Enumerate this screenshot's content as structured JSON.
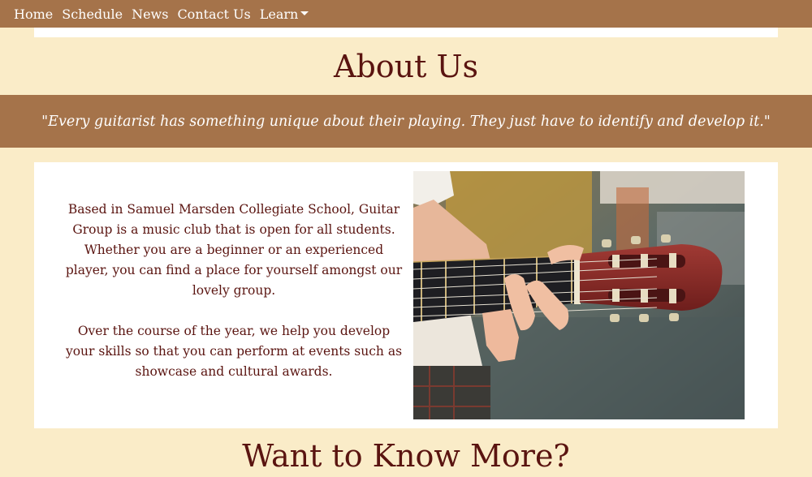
{
  "nav": {
    "items": [
      {
        "label": "Home"
      },
      {
        "label": "Schedule"
      },
      {
        "label": "News"
      },
      {
        "label": "Contact Us"
      },
      {
        "label": "Learn"
      }
    ]
  },
  "about": {
    "title": "About Us",
    "quote": "\"Every guitarist has something unique about their playing. They just have to identify and develop it.\"",
    "paragraph1": "Based in Samuel Marsden Collegiate School, Guitar Group is a music club that is open for all students. Whether you are a beginner or an experienced player, you can find a place for yourself amongst our lovely group.",
    "paragraph2": "Over the course of the year, we help you develop your skills so that you can perform at events such as showcase and cultural awards."
  },
  "more": {
    "title": "Want to Know More?"
  },
  "colors": {
    "background": "#faecc8",
    "brand": "#a5734a",
    "heading": "#5a1410",
    "card": "#ffffff"
  },
  "icons": {
    "dropdown": "caret-down-icon"
  }
}
